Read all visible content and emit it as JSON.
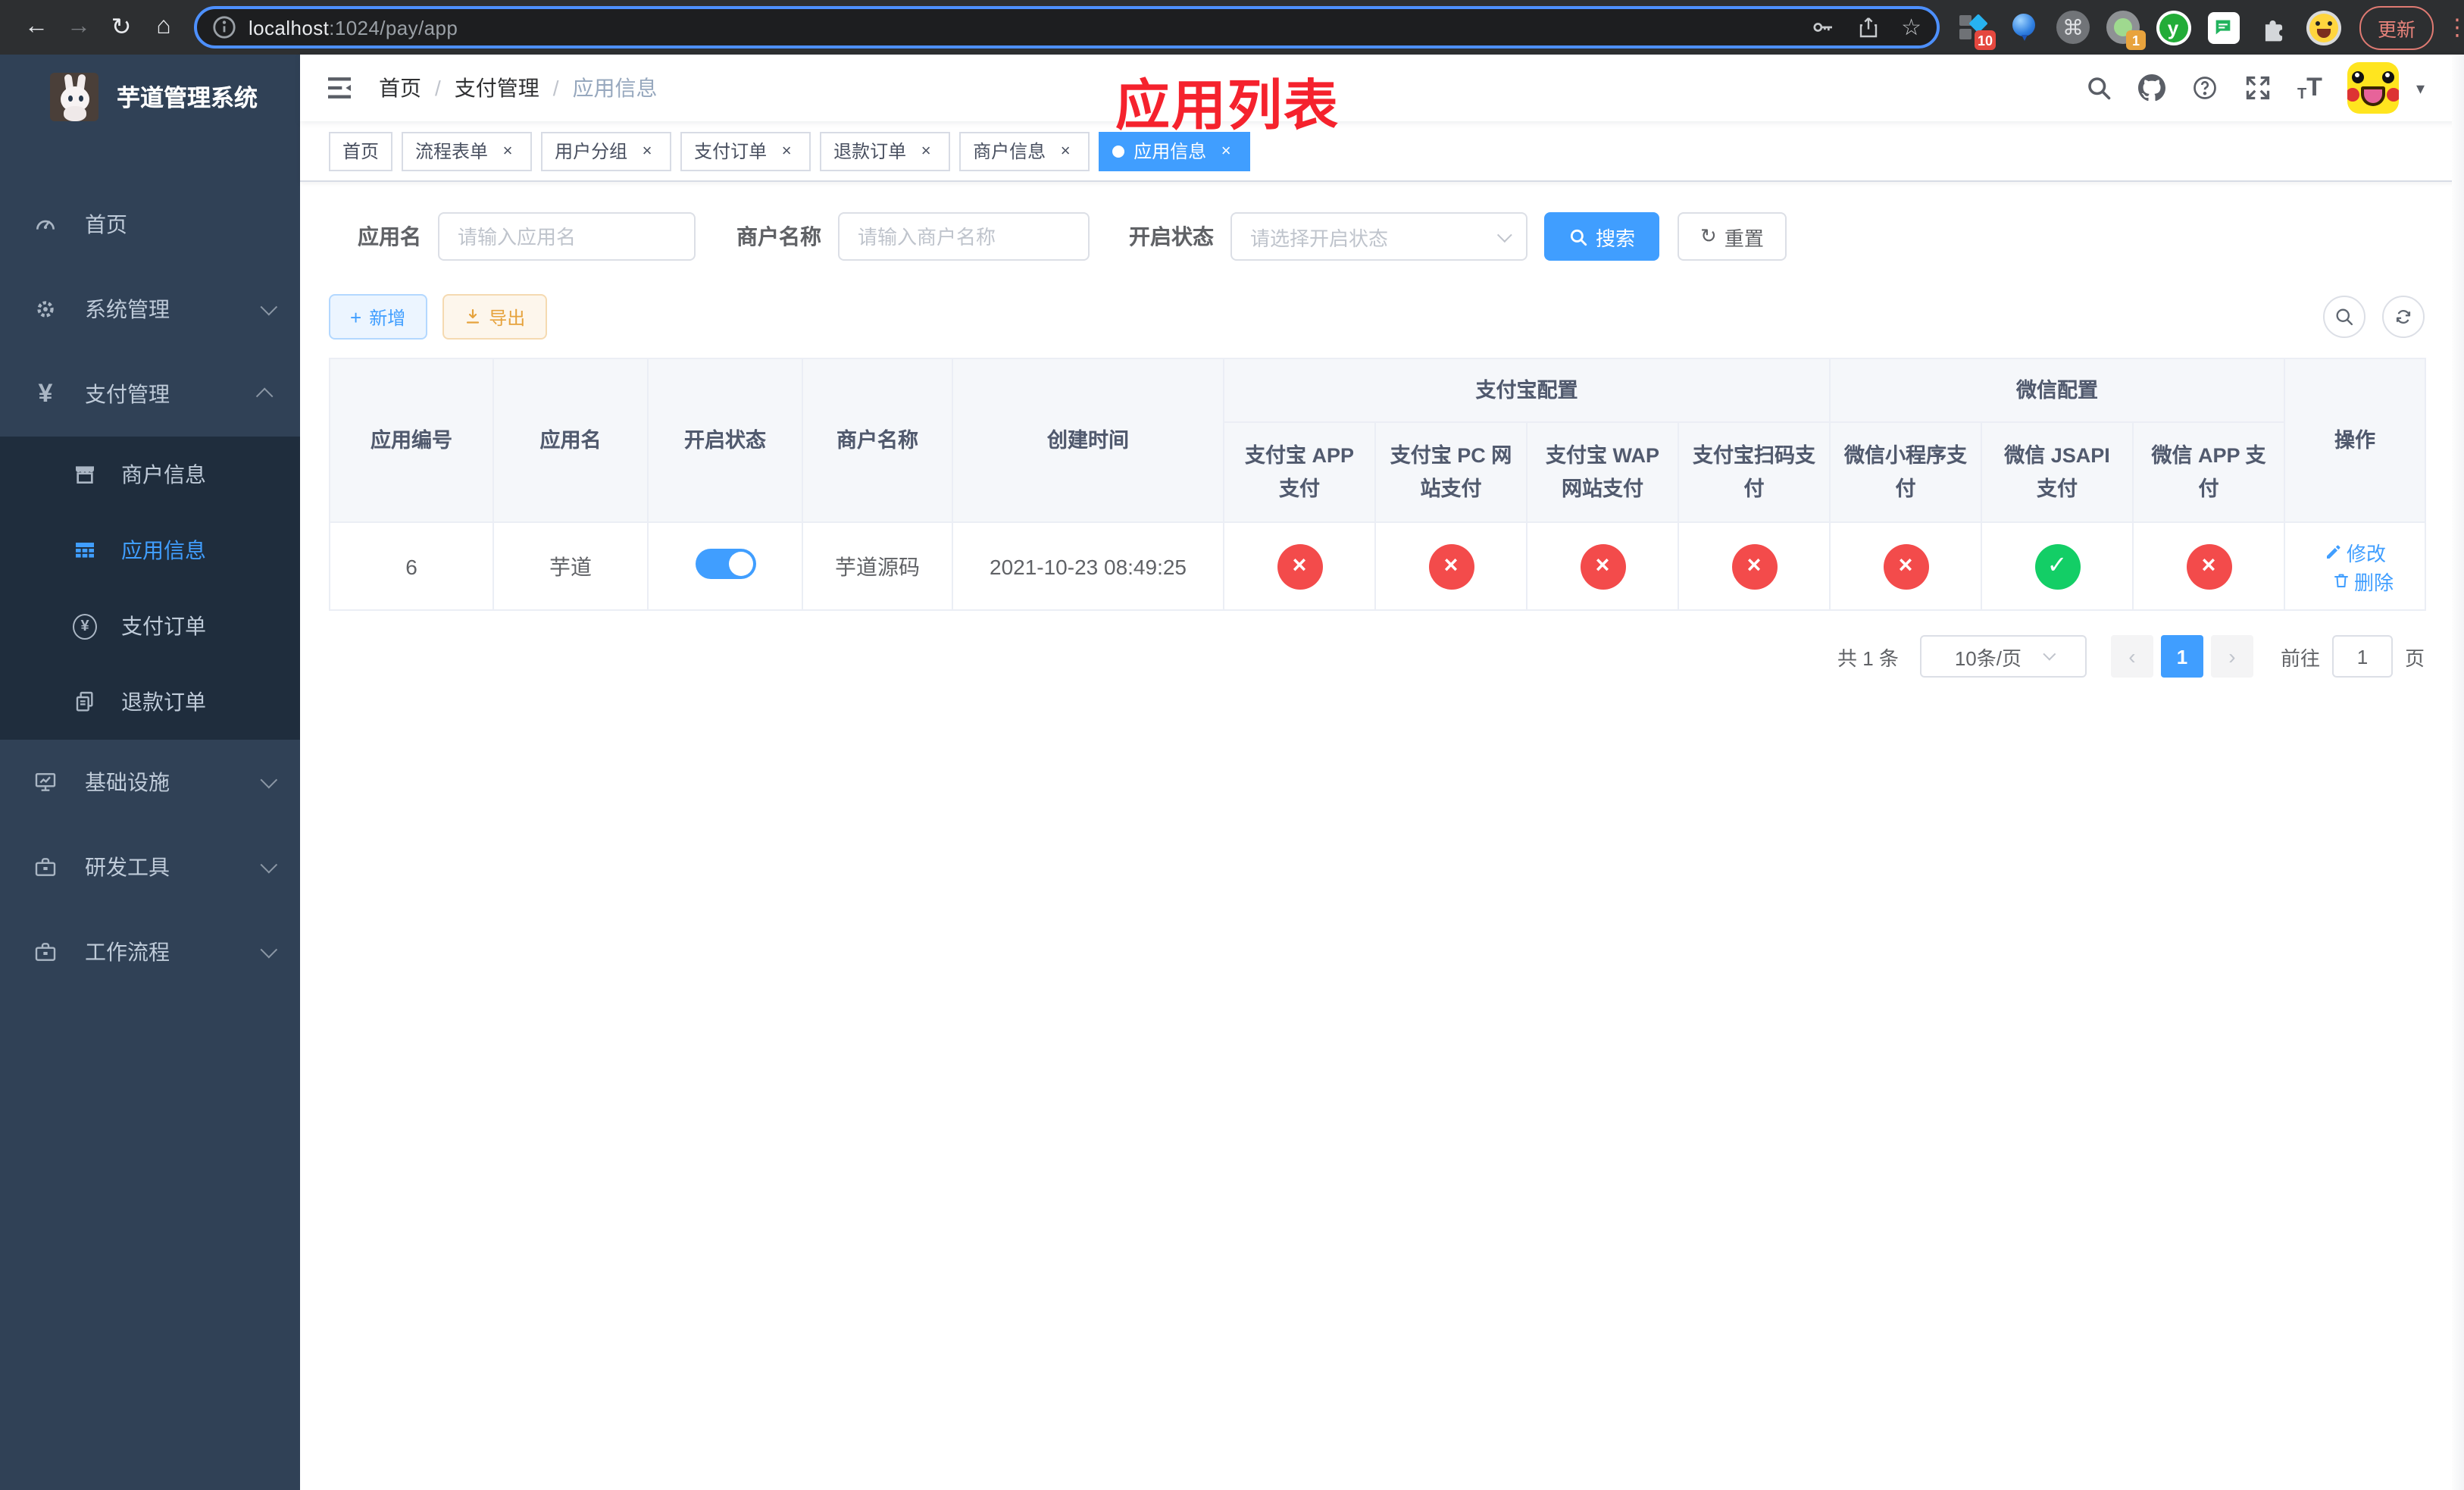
{
  "colors": {
    "primary": "#409eff",
    "success": "#13ce66",
    "danger": "#f34b4b",
    "annotation": "#f5222d",
    "warning": "#e6a23c",
    "sidebar_bg": "#304156",
    "submenu_bg": "#1f2d3d",
    "active_tab_bg": "#409eff"
  },
  "icons": {
    "close": "×",
    "active_dot": "●",
    "back": "←",
    "forward": "→",
    "reload": "↻",
    "home": "⌂",
    "star": "☆",
    "command": "⌘",
    "kebab": "⋮",
    "caret_down": "▾",
    "check": "✓",
    "cross": "×",
    "prev": "‹",
    "next": "›",
    "plus": "+",
    "reset_reload": "↻"
  },
  "browser": {
    "url": {
      "host": "localhost",
      "rest": ":1024/pay/app"
    },
    "badge_ten": "10",
    "badge_one": "1",
    "update_button": "更新"
  },
  "sidebar": {
    "app_title": "芋道管理系统",
    "items": [
      {
        "label": "首页"
      },
      {
        "label": "系统管理"
      },
      {
        "label": "支付管理"
      },
      {
        "label": "商户信息"
      },
      {
        "label": "应用信息"
      },
      {
        "label": "支付订单"
      },
      {
        "label": "退款订单"
      },
      {
        "label": "基础设施"
      },
      {
        "label": "研发工具"
      },
      {
        "label": "工作流程"
      }
    ]
  },
  "navbar": {
    "breadcrumb": {
      "home": "首页",
      "section": "支付管理",
      "current": "应用信息",
      "separator": "/"
    },
    "annotation": "应用列表"
  },
  "tabs": [
    {
      "label": "首页",
      "closable": false,
      "active": false
    },
    {
      "label": "流程表单",
      "closable": true,
      "active": false
    },
    {
      "label": "用户分组",
      "closable": true,
      "active": false
    },
    {
      "label": "支付订单",
      "closable": true,
      "active": false
    },
    {
      "label": "退款订单",
      "closable": true,
      "active": false
    },
    {
      "label": "商户信息",
      "closable": true,
      "active": false
    },
    {
      "label": "应用信息",
      "closable": true,
      "active": true
    }
  ],
  "filters": {
    "app_name": {
      "label": "应用名",
      "placeholder": "请输入应用名",
      "value": ""
    },
    "merchant_name": {
      "label": "商户名称",
      "placeholder": "请输入商户名称",
      "value": ""
    },
    "status": {
      "label": "开启状态",
      "placeholder": "请选择开启状态",
      "value": ""
    },
    "search_button": "搜索",
    "reset_button": "重置"
  },
  "toolbar": {
    "add_button": "新增",
    "export_button": "导出"
  },
  "table": {
    "columns": {
      "app_id": "应用编号",
      "app_name": "应用名",
      "status": "开启状态",
      "merchant": "商户名称",
      "created_at": "创建时间",
      "alipay_group": "支付宝配置",
      "wechat_group": "微信配置",
      "alipay_app": "支付宝 APP 支付",
      "alipay_pc": "支付宝 PC 网站支付",
      "alipay_wap": "支付宝 WAP 网站支付",
      "alipay_qr": "支付宝扫码支付",
      "wx_mini": "微信小程序支付",
      "wx_jsapi": "微信 JSAPI 支付",
      "wx_app": "微信 APP 支付",
      "actions": "操作"
    },
    "rows": [
      {
        "app_id": "6",
        "app_name": "芋道",
        "enabled": true,
        "merchant": "芋道源码",
        "created_at": "2021-10-23 08:49:25",
        "channel_status": [
          "disabled",
          "disabled",
          "disabled",
          "disabled",
          "disabled",
          "enabled",
          "disabled"
        ],
        "edit": "修改",
        "delete": "删除"
      }
    ]
  },
  "pagination": {
    "total_text": "共 1 条",
    "page_size": "10条/页",
    "current_page": "1",
    "goto_label": "前往",
    "goto_value": "1",
    "goto_suffix": "页"
  }
}
